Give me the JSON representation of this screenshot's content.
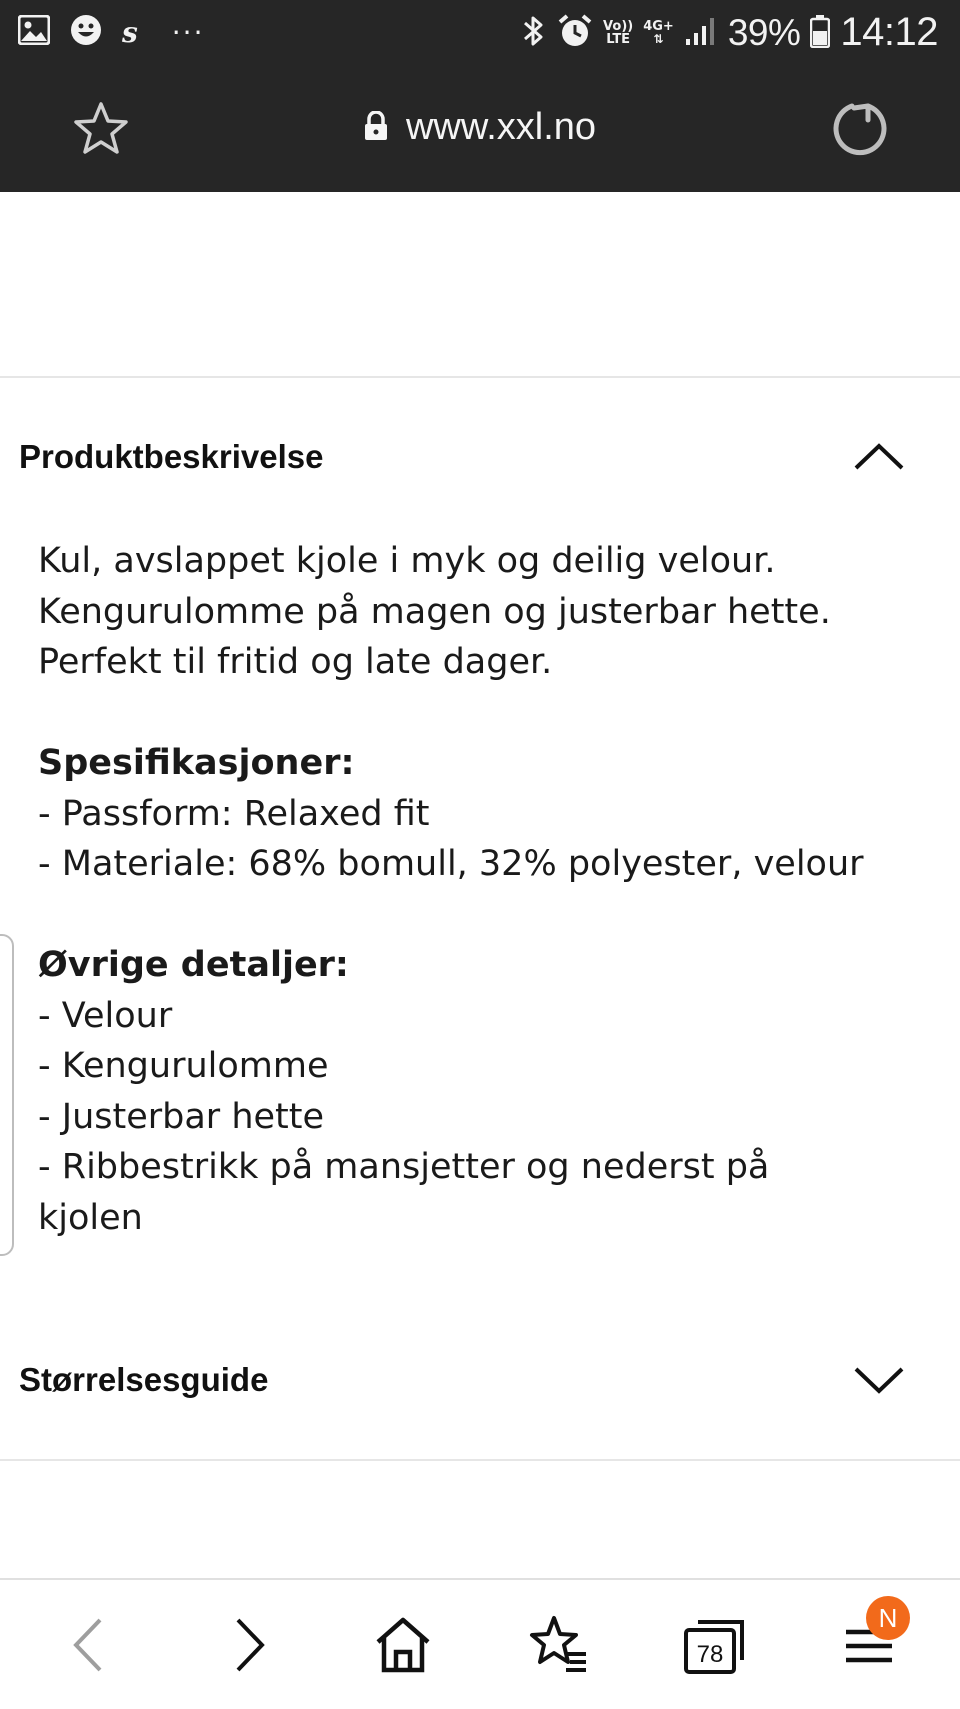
{
  "status_bar": {
    "battery_percent": "39%",
    "time": "14:12",
    "network_label": "4G+",
    "volte_label_top": "Vo))",
    "volte_label_bottom": "LTE",
    "overflow": "···",
    "icons": [
      "gallery-icon",
      "face-icon",
      "s-app-icon",
      "more-icon",
      "bluetooth-icon",
      "alarm-icon",
      "signal-icon",
      "battery-icon"
    ]
  },
  "url_bar": {
    "url": "www.xxl.no",
    "icons": [
      "star-icon",
      "lock-icon",
      "reload-icon"
    ]
  },
  "sections": {
    "description": {
      "title": "Produktbeskrivelse",
      "expanded": true,
      "intro": [
        "Kul, avslappet kjole i myk og deilig velour.",
        "Kengurulomme på magen og justerbar hette.",
        "Perfekt til fritid og late dager."
      ],
      "spec_heading": "Spesifikasjoner:",
      "specs": [
        "- Passform: Relaxed fit",
        "- Materiale: 68% bomull, 32% polyester, velour"
      ],
      "details_heading": "Øvrige detaljer:",
      "details": [
        "- Velour",
        "- Kengurulomme",
        "- Justerbar hette",
        "- Ribbestrikk på mansjetter og nederst på",
        "kjolen"
      ]
    },
    "size_guide": {
      "title": "Størrelsesguide",
      "expanded": false
    }
  },
  "bottom_nav": {
    "tab_count": "78",
    "badge": "N",
    "badge_color": "#f26a1b",
    "icons": [
      "back-icon",
      "forward-icon",
      "home-icon",
      "bookmarks-icon",
      "tabs-icon",
      "menu-icon"
    ]
  },
  "colors": {
    "bar_background": "#262626",
    "accent": "#f26a1b"
  }
}
